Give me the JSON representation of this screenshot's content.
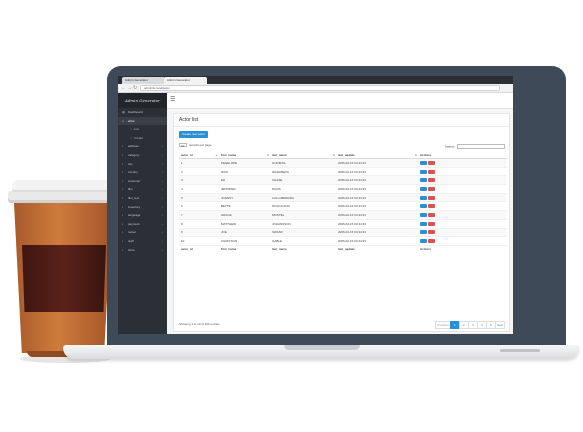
{
  "browser": {
    "tabs": [
      "Admin Generator",
      "Admin Generator"
    ],
    "url": "adminlte.local/actor"
  },
  "sidebar": {
    "app_title": "Admin Generator",
    "items": [
      {
        "label": "Dashboard",
        "icon": "dashboard-icon",
        "type": "item"
      },
      {
        "label": "actor",
        "icon": "user-icon",
        "type": "active"
      },
      {
        "label": "List",
        "icon": "circle-icon",
        "type": "sub"
      },
      {
        "label": "Create",
        "icon": "circle-icon",
        "type": "sub"
      },
      {
        "label": "address",
        "icon": "folder-icon",
        "type": "item"
      },
      {
        "label": "category",
        "icon": "folder-icon",
        "type": "item"
      },
      {
        "label": "city",
        "icon": "folder-icon",
        "type": "item"
      },
      {
        "label": "country",
        "icon": "folder-icon",
        "type": "item"
      },
      {
        "label": "customer",
        "icon": "folder-icon",
        "type": "item"
      },
      {
        "label": "film",
        "icon": "folder-icon",
        "type": "item"
      },
      {
        "label": "film_text",
        "icon": "folder-icon",
        "type": "item"
      },
      {
        "label": "inventory",
        "icon": "folder-icon",
        "type": "item"
      },
      {
        "label": "language",
        "icon": "folder-icon",
        "type": "item"
      },
      {
        "label": "payment",
        "icon": "folder-icon",
        "type": "item"
      },
      {
        "label": "rental",
        "icon": "folder-icon",
        "type": "item"
      },
      {
        "label": "staff",
        "icon": "folder-icon",
        "type": "item"
      },
      {
        "label": "store",
        "icon": "folder-icon",
        "type": "item"
      }
    ]
  },
  "main": {
    "title": "Actor list",
    "create_label": "Create new actor",
    "length_value": "10",
    "length_label": "records per page",
    "search_label": "Search:",
    "columns": [
      "actor_id",
      "first_name",
      "last_name",
      "last_update",
      "Actions"
    ],
    "rows": [
      [
        "1",
        "PENELOPE",
        "GUINESS",
        "2006-02-15 04:34:33"
      ],
      [
        "2",
        "NICK",
        "WAHLBERG",
        "2006-02-15 04:34:33"
      ],
      [
        "3",
        "ED",
        "CHASE",
        "2006-02-15 04:34:33"
      ],
      [
        "4",
        "JENNIFER",
        "DAVIS",
        "2006-02-15 04:34:33"
      ],
      [
        "5",
        "JOHNNY",
        "LOLLOBRIGIDA",
        "2006-02-15 04:34:33"
      ],
      [
        "6",
        "BETTE",
        "NICHOLSON",
        "2006-02-15 04:34:33"
      ],
      [
        "7",
        "GRACE",
        "MOSTEL",
        "2006-02-15 04:34:33"
      ],
      [
        "8",
        "MATTHEW",
        "JOHANSSON",
        "2006-02-15 04:34:33"
      ],
      [
        "9",
        "JOE",
        "SWANK",
        "2006-02-15 04:34:33"
      ],
      [
        "10",
        "CHRISTIAN",
        "GABLE",
        "2006-02-15 04:34:33"
      ]
    ],
    "info": "Showing 1 to 10 of 200 entries",
    "pagination": [
      "Previous",
      "1",
      "2",
      "3",
      "4",
      "5",
      "Next"
    ],
    "current_page": "1"
  },
  "colors": {
    "accent": "#2a8fd4",
    "danger": "#d9534f",
    "sidebar": "#2b2f36",
    "laptop": "#3f4a58",
    "coffee": "#cf7b3d",
    "sleeve": "#5c2219"
  }
}
